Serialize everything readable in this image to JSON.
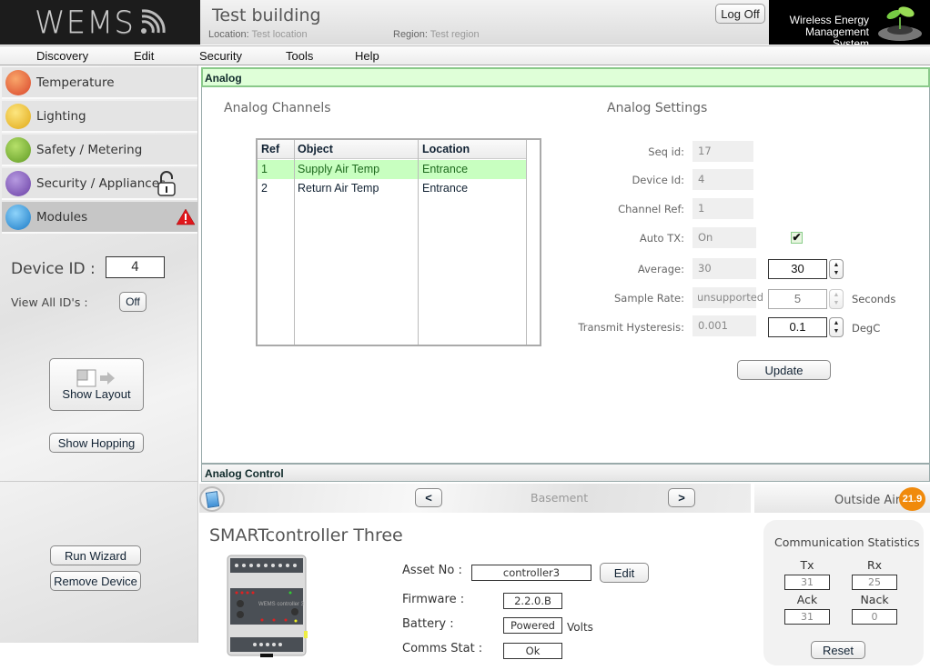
{
  "header": {
    "logo_text": "WEMS",
    "building_title": "Test building",
    "location_label": "Location:",
    "location_value": "Test location",
    "region_label": "Region:",
    "region_value": "Test region",
    "logoff_label": "Log Off",
    "brand_line1": "Wireless Energy",
    "brand_line2": "Management System"
  },
  "menu": [
    {
      "label": "Discovery"
    },
    {
      "label": "Edit"
    },
    {
      "label": "Security"
    },
    {
      "label": "Tools"
    },
    {
      "label": "Help"
    }
  ],
  "sidebar": {
    "items": [
      {
        "label": "Temperature",
        "icon": "thermometer-snowflake-icon"
      },
      {
        "label": "Lighting",
        "icon": "lightbulb-icon"
      },
      {
        "label": "Safety / Metering",
        "icon": "warning-meter-icon"
      },
      {
        "label": "Security / Appliances",
        "icon": "appliance-icon",
        "badge_icon": "unlocked-padlock-icon"
      },
      {
        "label": "Modules",
        "icon": "module-device-icon",
        "badge_icon": "alert-triangle-icon",
        "active": true
      }
    ],
    "device_id_label": "Device ID :",
    "device_id_value": "4",
    "view_all_label": "View All ID's :",
    "view_all_toggle": "Off",
    "show_layout_label": "Show Layout",
    "show_hopping_label": "Show Hopping",
    "run_wizard_label": "Run Wizard",
    "remove_device_label": "Remove Device"
  },
  "analog": {
    "panel_title": "Analog",
    "channels_title": "Analog Channels",
    "columns": [
      "Ref",
      "Object",
      "Location"
    ],
    "rows": [
      {
        "ref": "1",
        "object": "Supply Air Temp",
        "location": "Entrance",
        "selected": true
      },
      {
        "ref": "2",
        "object": "Return Air Temp",
        "location": "Entrance",
        "selected": false
      }
    ],
    "settings_title": "Analog Settings",
    "settings": {
      "seq_id_label": "Seq id:",
      "seq_id": "17",
      "device_id_label": "Device Id:",
      "device_id": "4",
      "channel_ref_label": "Channel Ref:",
      "channel_ref": "1",
      "auto_tx_label": "Auto TX:",
      "auto_tx": "On",
      "auto_tx_checked": true,
      "average_label": "Average:",
      "average": "30",
      "average_input": "30",
      "sample_rate_label": "Sample Rate:",
      "sample_rate": "unsupported",
      "sample_rate_input": "5",
      "sample_rate_unit": "Seconds",
      "hysteresis_label": "Transmit Hysteresis:",
      "hysteresis": "0.001",
      "hysteresis_input": "0.1",
      "hysteresis_unit": "DegC"
    },
    "update_label": "Update",
    "control_title": "Analog Control"
  },
  "floor_nav": {
    "prev_label": "<",
    "next_label": ">",
    "floor": "Basement",
    "outside_label": "Outside Air",
    "outside_value": "21.9",
    "outside_color": "#f08a0c"
  },
  "device": {
    "title": "SMARTcontroller Three",
    "asset_label": "Asset No :",
    "asset_value": "controller3",
    "edit_label": "Edit",
    "firmware_label": "Firmware :",
    "firmware_value": "2.2.0.B",
    "battery_label": "Battery :",
    "battery_value": "Powered",
    "battery_unit": "Volts",
    "comms_label": "Comms Stat :",
    "comms_value": "Ok"
  },
  "stats": {
    "title": "Communication Statistics",
    "tx_label": "Tx",
    "tx": "31",
    "rx_label": "Rx",
    "rx": "25",
    "ack_label": "Ack",
    "ack": "31",
    "nack_label": "Nack",
    "nack": "0",
    "reset_label": "Reset"
  }
}
